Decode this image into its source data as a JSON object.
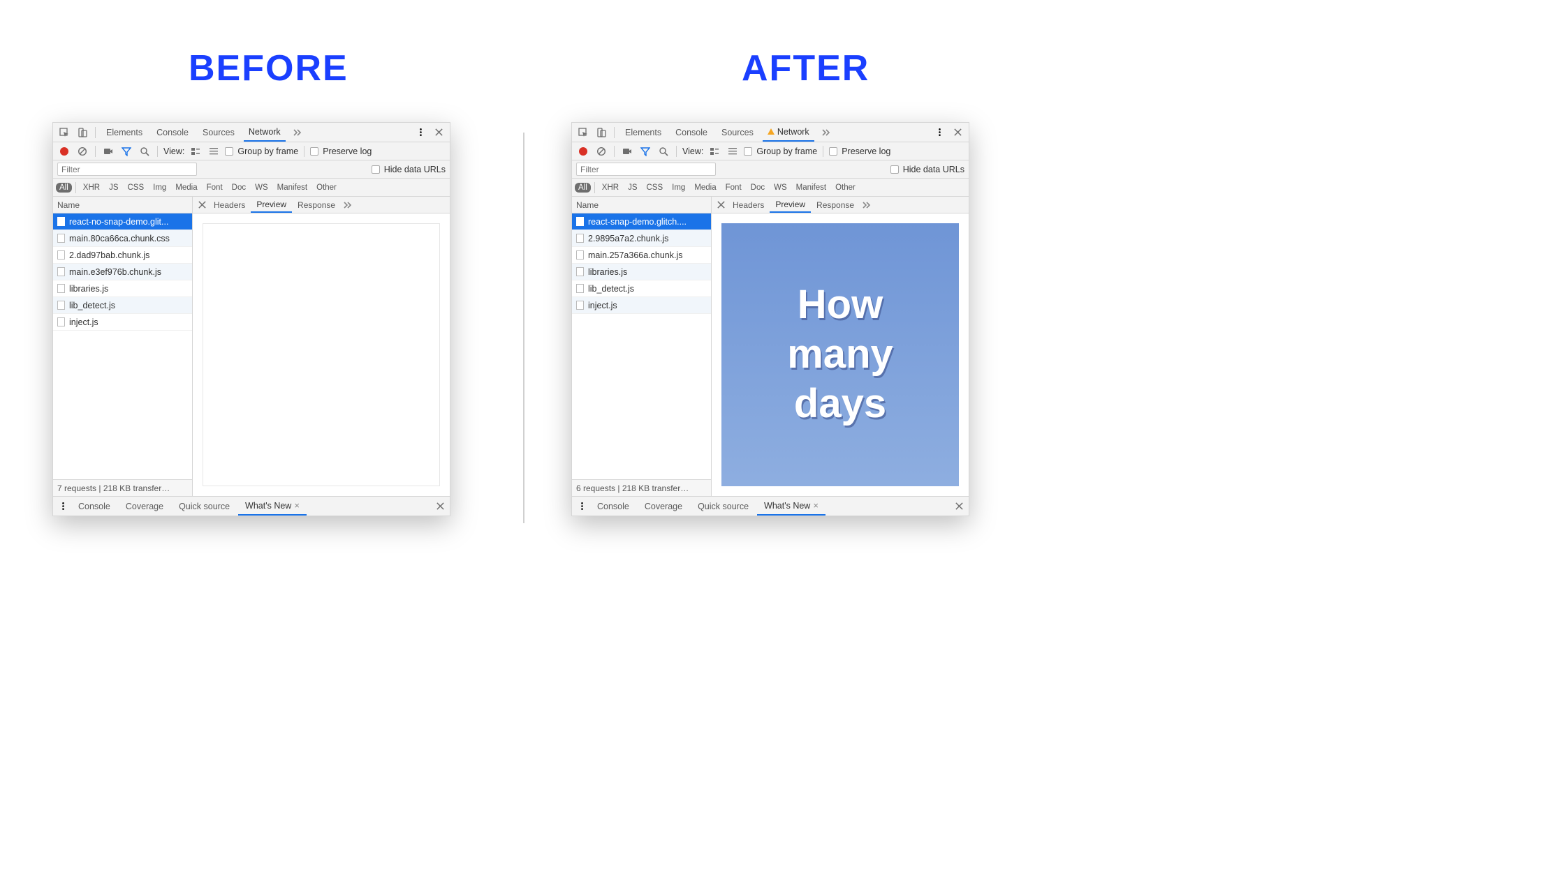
{
  "headings": {
    "before": "BEFORE",
    "after": "AFTER"
  },
  "devtools_tabs": [
    "Elements",
    "Console",
    "Sources",
    "Network"
  ],
  "toolbar": {
    "view_label": "View:",
    "group_by_frame": "Group by frame",
    "preserve_log": "Preserve log",
    "hide_data_urls": "Hide data URLs",
    "filter_placeholder": "Filter"
  },
  "type_filters": [
    "All",
    "XHR",
    "JS",
    "CSS",
    "Img",
    "Media",
    "Font",
    "Doc",
    "WS",
    "Manifest",
    "Other"
  ],
  "columns": {
    "name": "Name"
  },
  "detail_tabs": [
    "Headers",
    "Preview",
    "Response"
  ],
  "drawer_tabs": [
    "Console",
    "Coverage",
    "Quick source",
    "What's New"
  ],
  "panels": {
    "before": {
      "network_warn": false,
      "requests": [
        "react-no-snap-demo.glit...",
        "main.80ca66ca.chunk.css",
        "2.dad97bab.chunk.js",
        "main.e3ef976b.chunk.js",
        "libraries.js",
        "lib_detect.js",
        "inject.js"
      ],
      "summary": "7 requests | 218 KB transfer…",
      "preview_text": null
    },
    "after": {
      "network_warn": true,
      "requests": [
        "react-snap-demo.glitch....",
        "2.9895a7a2.chunk.js",
        "main.257a366a.chunk.js",
        "libraries.js",
        "lib_detect.js",
        "inject.js"
      ],
      "summary": "6 requests | 218 KB transfer…",
      "preview_text": [
        "How",
        "many",
        "days"
      ]
    }
  }
}
